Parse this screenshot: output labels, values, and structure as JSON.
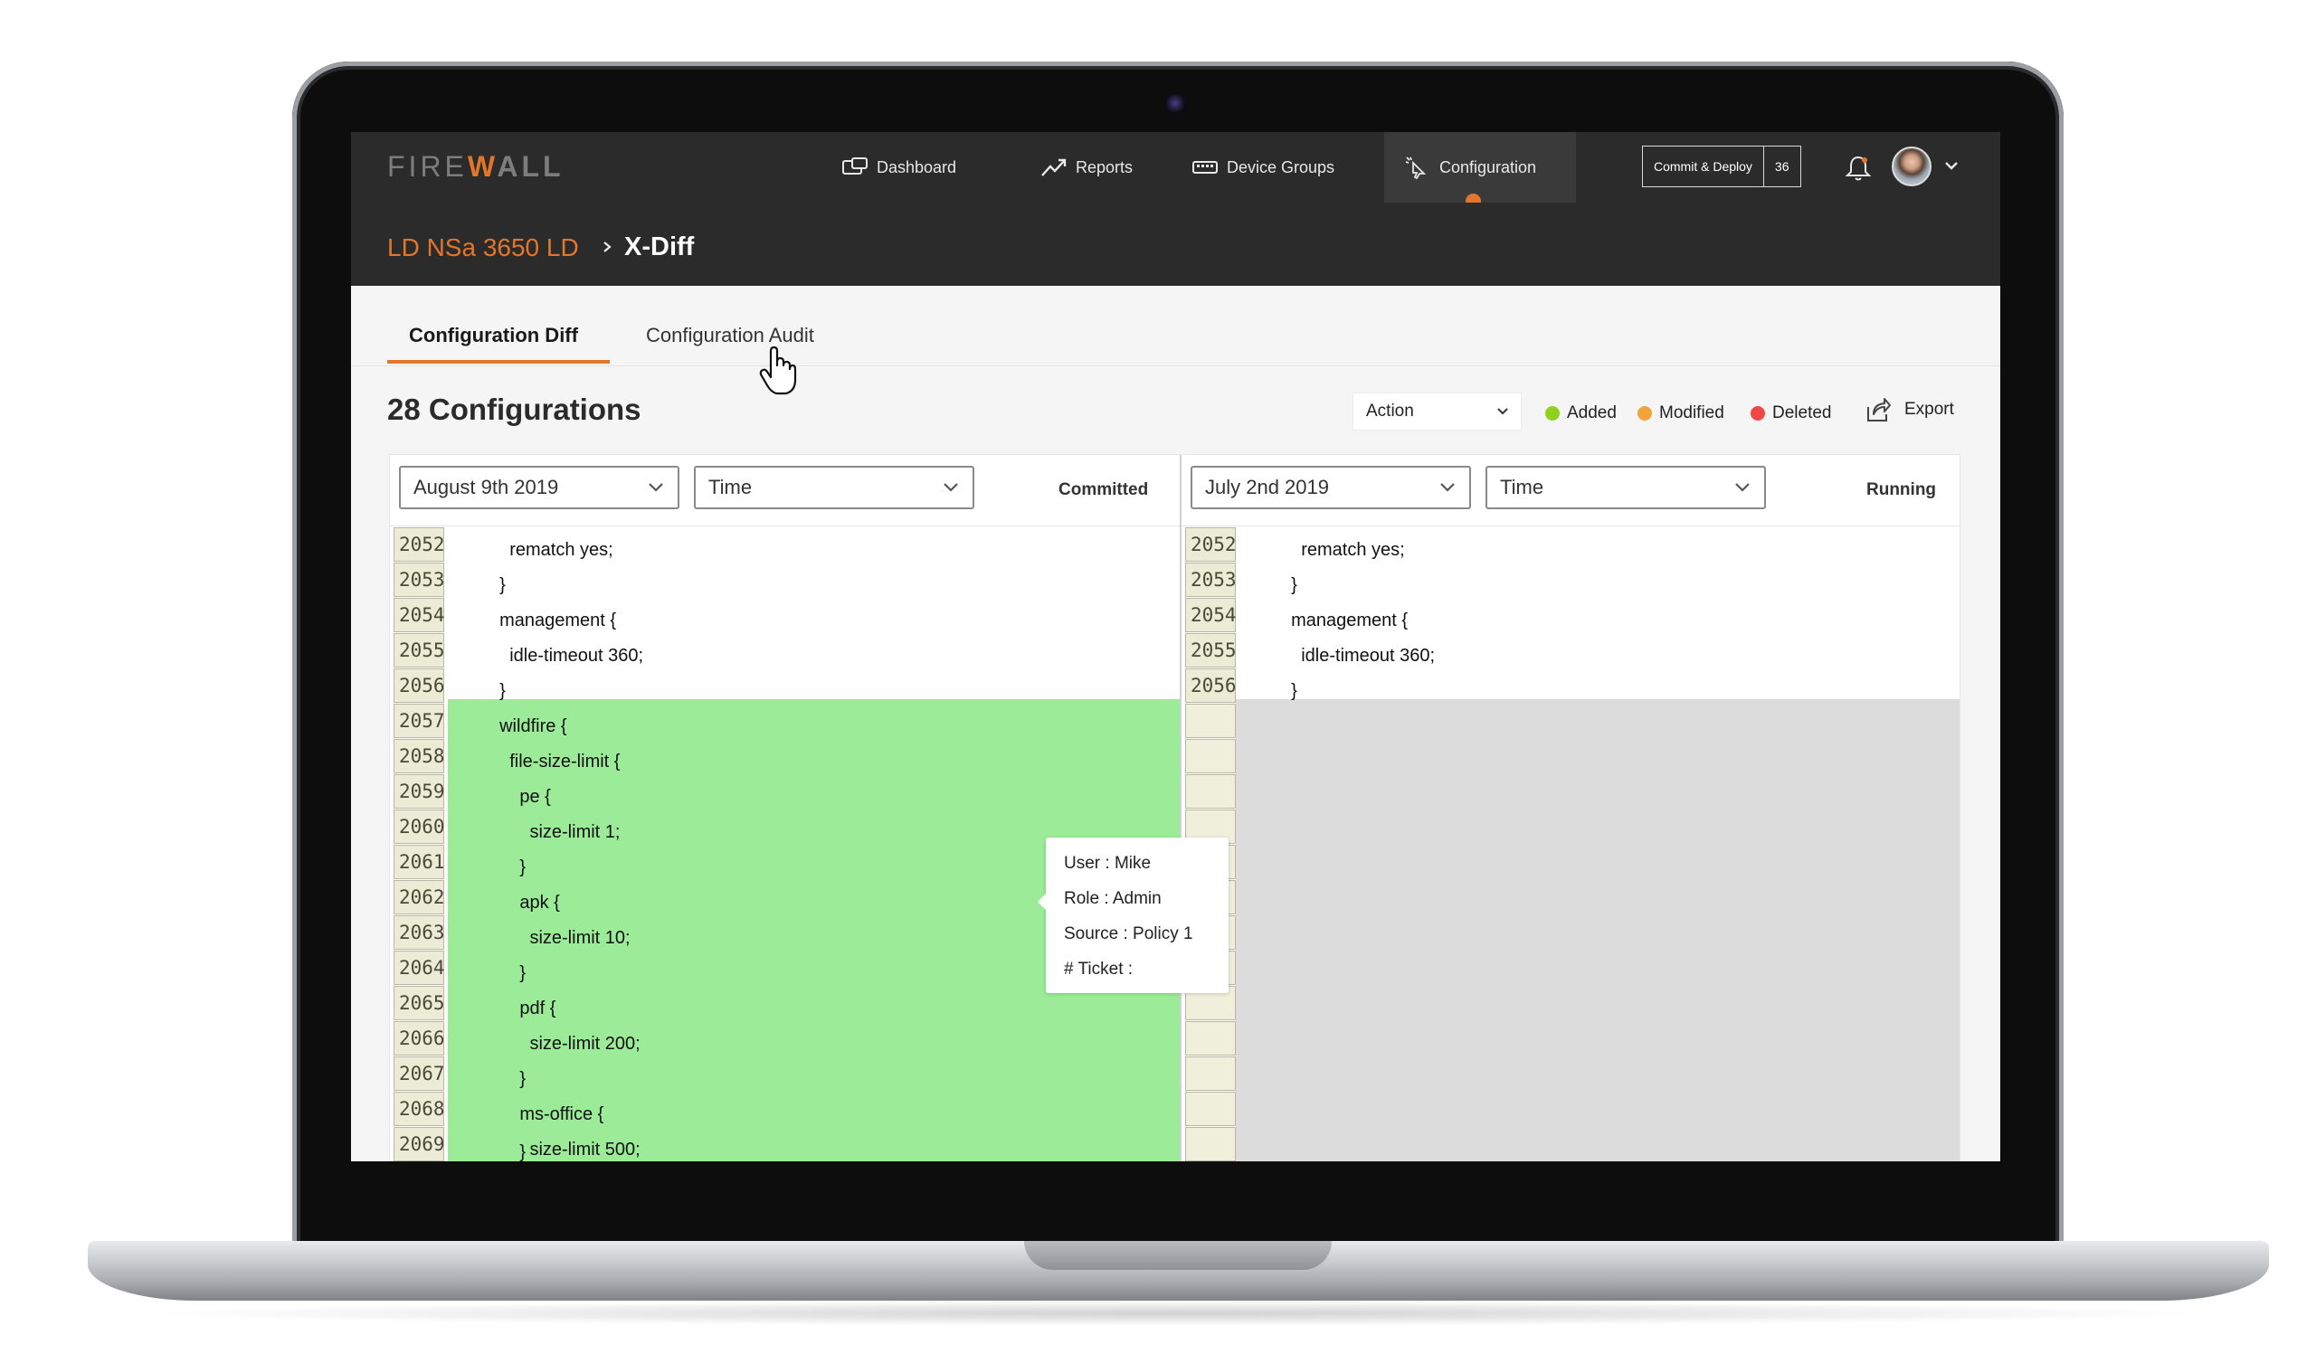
{
  "app": {
    "logo": {
      "part1": "FIRE",
      "part2": "W",
      "part3": "ALL"
    },
    "nav": [
      {
        "label": "Dashboard",
        "icon": "dashboard-icon"
      },
      {
        "label": "Reports",
        "icon": "trending-icon"
      },
      {
        "label": "Device Groups",
        "icon": "device-groups-icon"
      },
      {
        "label": "Configuration",
        "icon": "cursor-click-icon",
        "active": true
      }
    ],
    "commit": {
      "label": "Commit & Deploy",
      "count": "36"
    },
    "accent_color": "#e2762b"
  },
  "breadcrumb": {
    "parent": "LD NSa 3650 LD",
    "current": "X-Diff"
  },
  "tabs": [
    {
      "label": "Configuration Diff",
      "active": true
    },
    {
      "label": "Configuration Audit",
      "active": false
    }
  ],
  "toolbar": {
    "title": "28 Configurations",
    "action_label": "Action",
    "legend": [
      {
        "label": "Added",
        "color": "#8fd11f"
      },
      {
        "label": "Modified",
        "color": "#f2a33a"
      },
      {
        "label": "Deleted",
        "color": "#f04747"
      }
    ],
    "export_label": "Export"
  },
  "left": {
    "date": "August 9th 2019",
    "time": "Time",
    "state": "Committed",
    "context_lines": [
      {
        "no": "2052",
        "text": "    rematch yes;"
      },
      {
        "no": "2053",
        "text": "  }"
      },
      {
        "no": "2054",
        "text": "  management {"
      },
      {
        "no": "2055",
        "text": "    idle-timeout 360;"
      },
      {
        "no": "2056",
        "text": "  }"
      }
    ],
    "added_lines": [
      {
        "no": "2057",
        "text": "  wildfire {"
      },
      {
        "no": "2058",
        "text": "    file-size-limit {"
      },
      {
        "no": "2059",
        "text": "      pe {"
      },
      {
        "no": "2060",
        "text": "        size-limit 1;"
      },
      {
        "no": "2061",
        "text": "      }"
      },
      {
        "no": "2062",
        "text": "      apk {"
      },
      {
        "no": "2063",
        "text": "        size-limit 10;"
      },
      {
        "no": "2064",
        "text": "      }"
      },
      {
        "no": "2065",
        "text": "      pdf {"
      },
      {
        "no": "2066",
        "text": "        size-limit 200;"
      },
      {
        "no": "2067",
        "text": "      }"
      },
      {
        "no": "2068",
        "text": "      ms-office {"
      },
      {
        "no": "2069",
        "text": "        size-limit 500;"
      }
    ],
    "last_line": "      }"
  },
  "right": {
    "date": "July 2nd 2019",
    "time": "Time",
    "state": "Running",
    "context_lines": [
      {
        "no": "2052",
        "text": "    rematch yes;"
      },
      {
        "no": "2053",
        "text": "  }"
      },
      {
        "no": "2054",
        "text": "  management {"
      },
      {
        "no": "2055",
        "text": "    idle-timeout 360;"
      },
      {
        "no": "2056",
        "text": "  }"
      }
    ]
  },
  "tooltip": {
    "user": "User : Mike",
    "role": "Role : Admin",
    "source": "Source : Policy 1",
    "ticket": "# Ticket :"
  }
}
